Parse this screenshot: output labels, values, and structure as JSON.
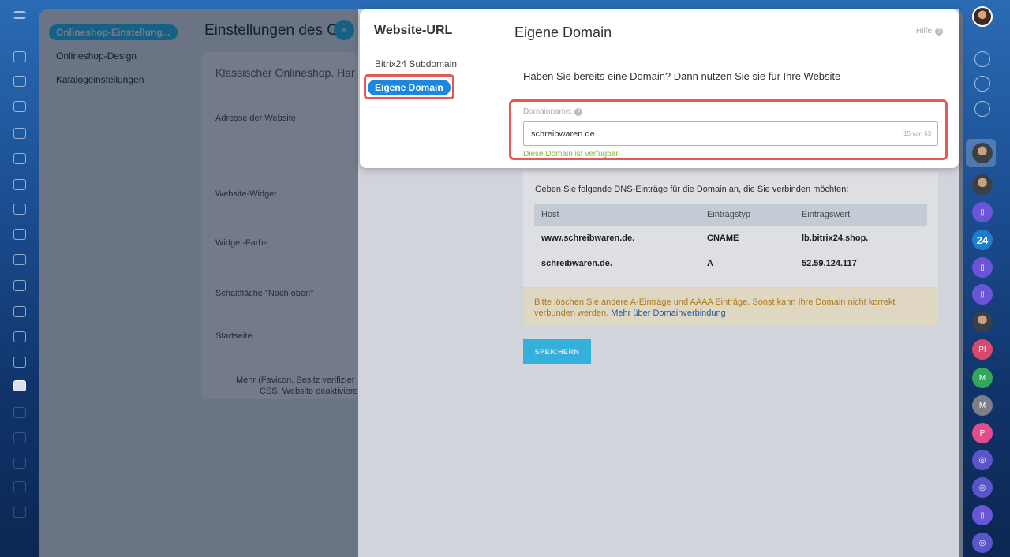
{
  "background": {
    "sidebar": {
      "active_item": "Onlineshop-Einstellung...",
      "items": [
        "Onlineshop-Design",
        "Katalogeinstellungen"
      ]
    },
    "page_title": "Einstellungen des O",
    "card": {
      "heading": "Klassischer Onlineshop. Har",
      "fields": [
        "Adresse der Website",
        "Website-Widget",
        "Widget-Farbe",
        "Schaltfläche \"Nach oben\"",
        "Startseite"
      ],
      "more_line1": "Mehr (Favicon, Besitz verifizier",
      "more_line2": "CSS, Website deaktiviere"
    },
    "close_button": "×"
  },
  "popup": {
    "title": "Website-URL",
    "menu": [
      "Bitrix24 Subdomain",
      "Eigene Domain"
    ],
    "section_title": "Eigene Domain",
    "help": "Hilfe",
    "question": "Haben Sie bereits eine Domain? Dann nutzen Sie sie für Ihre Website",
    "domain_label": "Domainname:",
    "domain_value": "schreibwaren.de",
    "char_count": "15 von 63",
    "status": "Diese Domain ist verfügbar."
  },
  "dns": {
    "intro": "Geben Sie folgende DNS-Einträge für die Domain an, die Sie verbinden möchten:",
    "columns": [
      "Host",
      "Eintragstyp",
      "Eintragswert"
    ],
    "rows": [
      [
        "www.schreibwaren.de.",
        "CNAME",
        "lb.bitrix24.shop."
      ],
      [
        "schreibwaren.de.",
        "A",
        "52.59.124.117"
      ]
    ]
  },
  "warning": {
    "text": "Bitte löschen Sie andere A-Einträge und AAAA Einträge. Sonst kann Ihre Domain nicht korrekt verbunden werden.",
    "link": "Mehr über Domainverbindung"
  },
  "save_label": "SPEICHERN",
  "right_rail": {
    "badge_24": "24",
    "initials": [
      "PI",
      "M",
      "M",
      "P"
    ]
  },
  "colors": {
    "accent_blue": "#1b86e3",
    "highlight_red": "#e25a54",
    "success_green": "#7dbb2b",
    "save_button": "#3bc8f5"
  }
}
